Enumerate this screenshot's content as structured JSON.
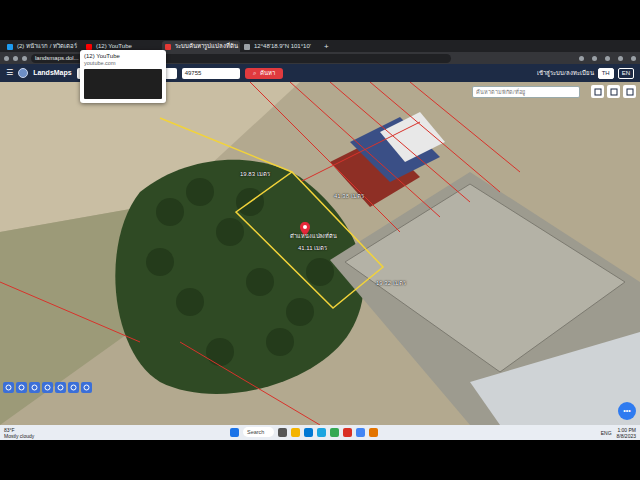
{
  "browser": {
    "tabs": [
      {
        "label": "(2) หน้าแรก / ทวิตเตอร์",
        "selected": false,
        "color": "#1d9bf0"
      },
      {
        "label": "(12) YouTube",
        "selected": false,
        "color": "#ff0000"
      },
      {
        "label": "ระบบค้นหารูปแปลงที่ดิน",
        "selected": true,
        "color": "#e53935"
      },
      {
        "label": "12°48'18.9\"N 101°10'",
        "selected": false,
        "color": "#9aa0a6"
      }
    ],
    "new_tab": "+",
    "tooltip": {
      "title": "(12) YouTube",
      "url": "youtube.com"
    },
    "address": "landsmaps.dol..."
  },
  "site": {
    "menu": "☰",
    "logo": "LandsMaps",
    "search_value": "49755",
    "search_button": "ค้นหา",
    "login": "เข้าสู่ระบบ/ลงทะเบียน",
    "languages": [
      {
        "label": "TH",
        "selected": true
      },
      {
        "label": "EN",
        "selected": false
      }
    ]
  },
  "map": {
    "search_placeholder": "ค้นหาตามพิกัด/ที่อยู่",
    "pin_label": "ตำแหน่งแปลงที่ดิน",
    "measurements": [
      {
        "text": "19.83 เมตร"
      },
      {
        "text": "41.38 เมตร"
      },
      {
        "text": "41.11 เมตร"
      },
      {
        "text": "19.32 เมตร"
      }
    ],
    "fab": "•••"
  },
  "taskbar": {
    "temp": "83°F",
    "weather": "Mostly cloudy",
    "search": "Search",
    "lang": "ENG",
    "time": "1:00 PM",
    "date": "8/8/2023"
  }
}
